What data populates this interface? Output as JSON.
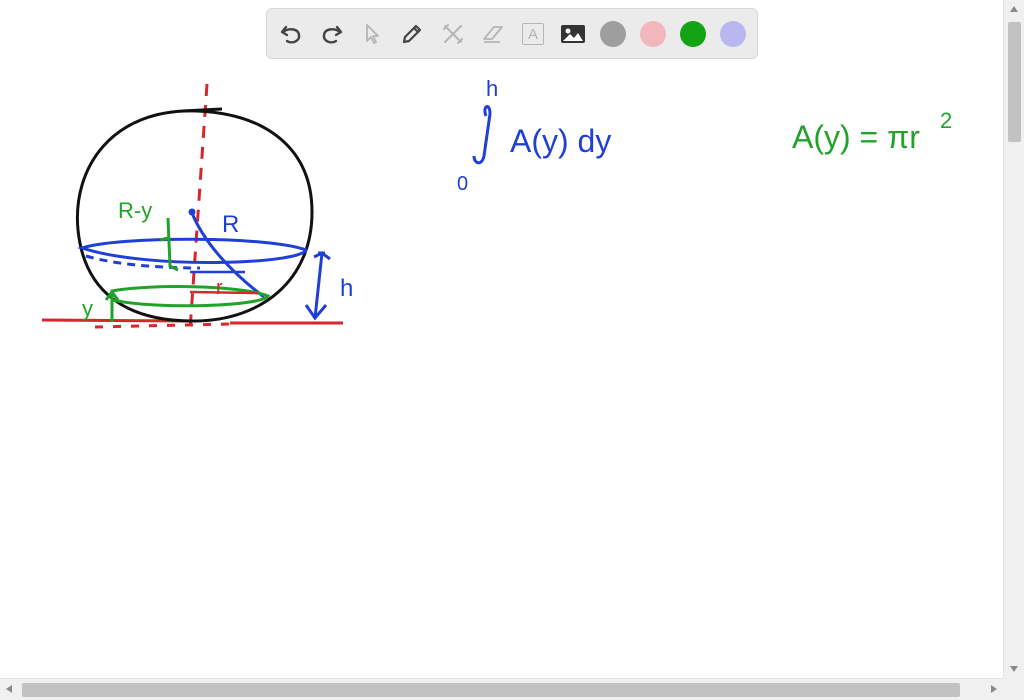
{
  "toolbar": {
    "tools": [
      {
        "name": "undo-icon"
      },
      {
        "name": "redo-icon"
      },
      {
        "name": "select-arrow-icon"
      },
      {
        "name": "pencil-icon"
      },
      {
        "name": "tools-icon"
      },
      {
        "name": "eraser-icon"
      },
      {
        "name": "text-icon",
        "label": "A"
      },
      {
        "name": "image-icon"
      }
    ],
    "colors": [
      "#9e9e9e",
      "#f2b6bd",
      "#14a314",
      "#b9b6f0"
    ],
    "selected_color": "#14a314"
  },
  "canvas": {
    "ink_colors": {
      "black": "#111111",
      "red": "#d8262c",
      "blue": "#1f3fd6",
      "green": "#21a32a"
    },
    "labels": {
      "radius": "R",
      "r_minus_y": "R-y",
      "small_r": "r",
      "height": "h",
      "y": "y",
      "upper_limit": "h",
      "lower_limit": "0",
      "integrand": "A(y) dy",
      "area_formula": "A(y) = πr",
      "exponent": "2"
    }
  }
}
